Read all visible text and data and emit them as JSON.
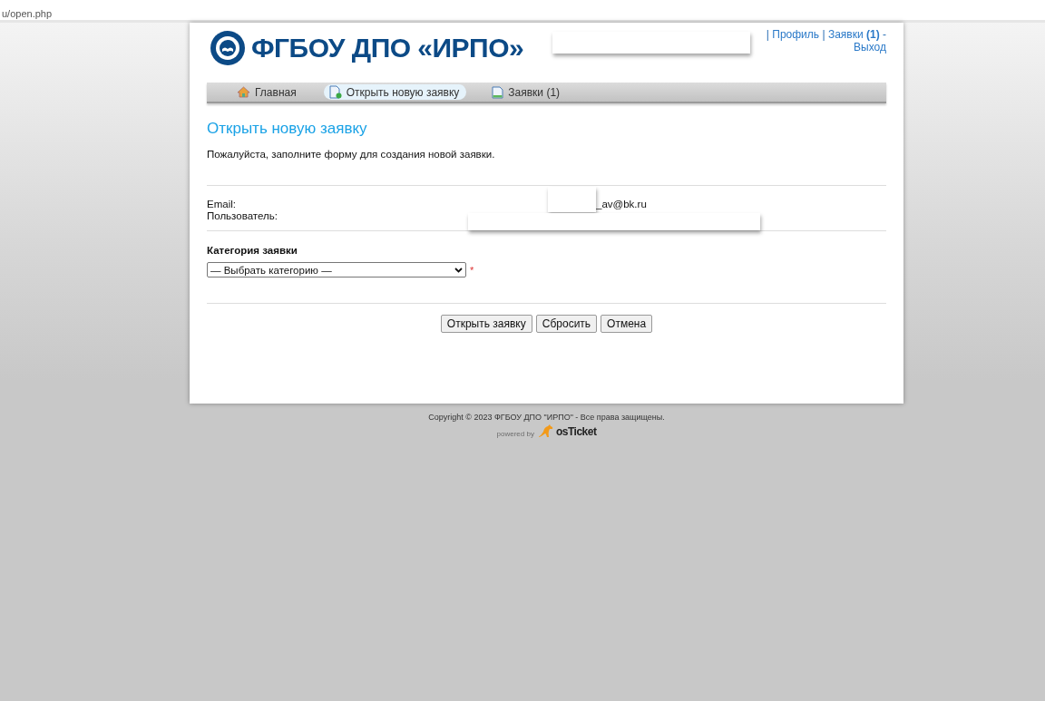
{
  "address_bar": {
    "url": "u/open.php"
  },
  "header": {
    "logo_text": "ФГБОУ ДПО «ИРПО»",
    "user_links": [
      {
        "kind": "sep",
        "text": "|"
      },
      {
        "kind": "link",
        "text": "Профиль"
      },
      {
        "kind": "sep",
        "text": "|"
      },
      {
        "kind": "link",
        "text": "Заявки **(1)**"
      },
      {
        "kind": "sep",
        "text": "-"
      },
      {
        "kind": "link",
        "text": "Выход"
      }
    ]
  },
  "nav": [
    {
      "label": "Главная",
      "kind": "home",
      "selected": false
    },
    {
      "label": "Открыть новую заявку",
      "kind": "new",
      "selected": true
    },
    {
      "label": "Заявки (1)",
      "kind": "tickets",
      "selected": false
    }
  ],
  "page_title": "Открыть новую заявку",
  "intro": "Пожалуйста, заполните форму для создания новой заявки.",
  "user_info": [
    {
      "label": "Email:",
      "value": "_av@bk.ru"
    },
    {
      "label": "Пользователь:"
    }
  ],
  "category": {
    "label": "Категория заявки",
    "value": "— Выбрать категорию —",
    "required_mark": "*"
  },
  "buttons": [
    "Открыть заявку",
    "Сбросить",
    "Отмена"
  ],
  "footer": {
    "copyright": "Copyright © 2023 ФГБОУ ДПО \"ИРПО\" - Все права защищены.",
    "powered_by": "powered by",
    "brand": "osTicket"
  }
}
